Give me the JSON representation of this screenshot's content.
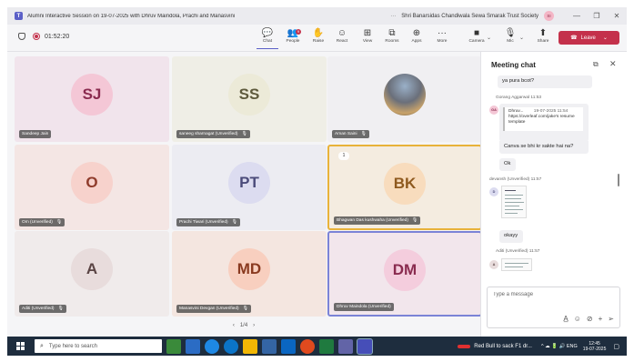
{
  "window": {
    "title": "Alumni Interactive Session on 19-07-2025 with Dhruv Maindola, Prachi and Manasvini",
    "org": "Shri Banarsidas Chandiwala Sewa Smarak Trust Society",
    "avatar": "SI",
    "more": "···",
    "minimize": "—",
    "restore": "❐",
    "close": "✕"
  },
  "toolbar": {
    "timer": "01:52:20",
    "buttons": [
      {
        "label": "Chat",
        "icon": "💬"
      },
      {
        "label": "People",
        "icon": "👥",
        "badge": "9"
      },
      {
        "label": "Raise",
        "icon": "✋"
      },
      {
        "label": "React",
        "icon": "☺"
      },
      {
        "label": "View",
        "icon": "⊞"
      },
      {
        "label": "Rooms",
        "icon": "⧉"
      },
      {
        "label": "Apps",
        "icon": "⊕"
      },
      {
        "label": "More",
        "icon": "···"
      },
      {
        "label": "Camera",
        "icon": "■"
      },
      {
        "label": "Mic",
        "icon": "🎙"
      },
      {
        "label": "Share",
        "icon": "⬆"
      }
    ],
    "chevron": "⌄",
    "leave_label": "Leave",
    "leave_icon": "☎"
  },
  "participants": [
    {
      "name": "Sandeep Jain",
      "initials": "SJ",
      "bg": "#f1e4ec",
      "avbg": "#f4c7d6",
      "color": "#8a2b4f"
    },
    {
      "name": "saneeg sharnagat (Unverified)",
      "initials": "SS",
      "bg": "#efeee6",
      "avbg": "#ecead8",
      "color": "#5e5a3c",
      "mic_off": "🎙"
    },
    {
      "name": "Aman Saini",
      "initials": "",
      "bg": "#f0eff2",
      "photo": true,
      "mic_off": "🎙"
    },
    {
      "name": "Om (Unverified)",
      "initials": "O",
      "bg": "#f4e6e4",
      "avbg": "#f7d2cc",
      "color": "#8f3b2b",
      "mic_off": "🎙"
    },
    {
      "name": "Prachi Tiwari (Unverified)",
      "initials": "PT",
      "bg": "#ececf2",
      "avbg": "#dcdcf0",
      "color": "#4b4b7a",
      "mic_off": "🎙"
    },
    {
      "name": "Bhagwan Das kushwaha (Unverified)",
      "initials": "BK",
      "bg": "#f4ece0",
      "avbg": "#f8dcbd",
      "color": "#8f5a1f",
      "mic_off": "🎙",
      "active": true,
      "spotlight": "1"
    },
    {
      "name": "Aditi (Unverified)",
      "initials": "A",
      "bg": "#f0ebeb",
      "avbg": "#e8dcdc",
      "color": "#5a4444",
      "mic_off": "🎙"
    },
    {
      "name": "Manasvini Devgan (Unverified)",
      "initials": "MD",
      "bg": "#f4e6e0",
      "avbg": "#f8cfbf",
      "color": "#8a3a20",
      "mic_off": "🎙"
    },
    {
      "name": "Dhruv Maindola (Unverified)",
      "initials": "DM",
      "bg": "#f2e6ec",
      "avbg": "#f4cddd",
      "color": "#8a2b4f",
      "pinned": true
    }
  ],
  "pager": {
    "prev": "‹",
    "label": "1/4",
    "next": "›"
  },
  "chat": {
    "title": "Meeting chat",
    "popout_icon": "⧉",
    "close_icon": "✕",
    "messages": {
      "m0": "ya pura bcot?",
      "m1_meta": "Gorang Aggarwal   11:53",
      "m2_avatar": "GA",
      "m2_quote_sender": "Dhruv...",
      "m2_quote_time": "19-07-2025 11:54",
      "m2_quote_text": "https://overleaf.com/jake's resume template",
      "m2_text": "Canva se bhi kr sakte hai na?",
      "m3_text": "Ok",
      "m4_meta": "devansh (Unverified)   11:57",
      "m4_avatar": "D",
      "m5_text": "okayy",
      "m6_meta": "Aditi (Unverified)   11:57",
      "m6_avatar": "A"
    },
    "input_placeholder": "Type a message",
    "input_icons": {
      "format": "A̲",
      "emoji": "☺",
      "attach": "⊘",
      "plus": "+",
      "send": "➢"
    }
  },
  "taskbar": {
    "search_placeholder": "Type here to search",
    "search_icon": "⌕",
    "news": "Red Bull to sack F1 dr...",
    "tray": "^  ☁  🔋  🔊  ENG",
    "time": "12:45",
    "date": "19-07-2025",
    "notif": "▢"
  }
}
